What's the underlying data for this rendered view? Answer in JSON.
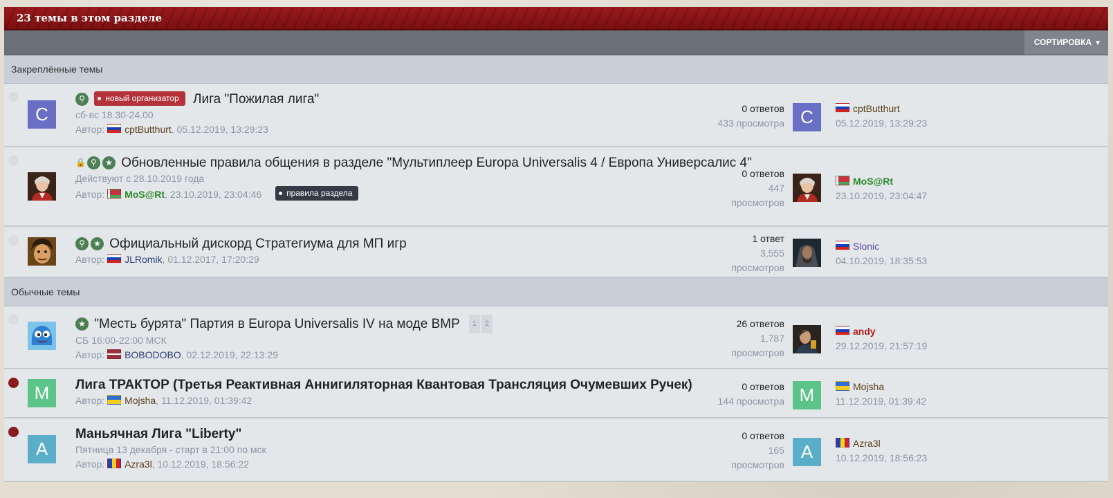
{
  "header": {
    "title": "23 темы в этом разделе"
  },
  "toolbar": {
    "sort_label": "СОРТИРОВКА"
  },
  "groups": {
    "pinned": "Закреплённые темы",
    "normal": "Обычные темы"
  },
  "colors": {
    "header_red": "#8d1317",
    "tag_red": "#b6323a",
    "tag_dark": "#353b45",
    "pin_green": "#4c7f52",
    "unread_dot": "#8b1a1a"
  },
  "topics": [
    {
      "avatar_letter": "C",
      "avatar_color": "#6a6fc6",
      "tag": "новый организатор",
      "title": "Лига \"Пожилая лига\"",
      "subtitle": "сб-вс 18.30-24.00",
      "author_prefix": "Автор:",
      "author": "cptButthurt",
      "author_flag": "ru",
      "date": ", 05.12.2019, 13:29:23",
      "replies": "0 ответов",
      "views": "433 просмотра",
      "last_avatar_letter": "C",
      "last_user": "cptButthurt",
      "last_flag": "ru",
      "last_date": "05.12.2019, 13:29:23"
    },
    {
      "title": "Обновленные правила общения в разделе \"Мультиплеер Europa Universalis 4 / Европа Универсалис 4\"",
      "subtitle": "Действуют с 28.10.2019 года",
      "author_prefix": "Автор:",
      "author": "MoS@Rt",
      "author_flag": "by",
      "date": ", 23.10.2019, 23:04:46",
      "tag": "правила раздела",
      "replies": "0 ответов",
      "views_1": "447",
      "views_2": "просмотров",
      "last_user": "MoS@Rt",
      "last_flag": "by",
      "last_date": "23.10.2019, 23:04:47"
    },
    {
      "title": "Официальный дискорд Стратегиума для МП игр",
      "author_prefix": "Автор:",
      "author": "JLRomik",
      "author_flag": "ru",
      "date": ", 01.12.2017, 17:20:29",
      "replies": "1 ответ",
      "views_1": "3,555",
      "views_2": "просмотров",
      "last_user": "Slonic",
      "last_flag": "ru",
      "last_date": "04.10.2019, 18:35:53"
    },
    {
      "title": "\"Месть бурята\" Партия в Europa Universalis IV на моде BMP",
      "pages": [
        "1",
        "2"
      ],
      "subtitle": "СБ 16:00-22:00 МСК",
      "author_prefix": "Автор:",
      "author": "BOBODOBO",
      "author_flag": "lv",
      "date": ", 02.12.2019, 22:13:29",
      "replies": "26 ответов",
      "views_1": "1,787",
      "views_2": "просмотров",
      "last_user": "andy",
      "last_flag": "ru",
      "last_date": "29.12.2019, 21:57:19"
    },
    {
      "avatar_letter": "M",
      "avatar_color": "#5cc488",
      "title": "Лига ТРАКТОР (Третья Реактивная Аннигиляторная Квантовая Трансляция Очумевших Ручек)",
      "author_prefix": "Автор:",
      "author": "Mojsha",
      "author_flag": "ua",
      "date": ", 11.12.2019, 01:39:42",
      "replies": "0 ответов",
      "views": "144 просмотра",
      "last_avatar_letter": "M",
      "last_user": "Mojsha",
      "last_flag": "ua",
      "last_date": "11.12.2019, 01:39:42"
    },
    {
      "avatar_letter": "A",
      "avatar_color": "#5aaec8",
      "title": "Маньячная Лига \"Liberty\"",
      "subtitle": "Пятница 13 декабря - старт в 21:00 по мск",
      "author_prefix": "Автор:",
      "author": "Azra3l",
      "author_flag": "md",
      "date": ", 10.12.2019, 18:56:22",
      "replies": "0 ответов",
      "views_1": "165",
      "views_2": "просмотров",
      "last_avatar_letter": "A",
      "last_user": "Azra3l",
      "last_flag": "md",
      "last_date": "10.12.2019, 18:56:23"
    }
  ]
}
